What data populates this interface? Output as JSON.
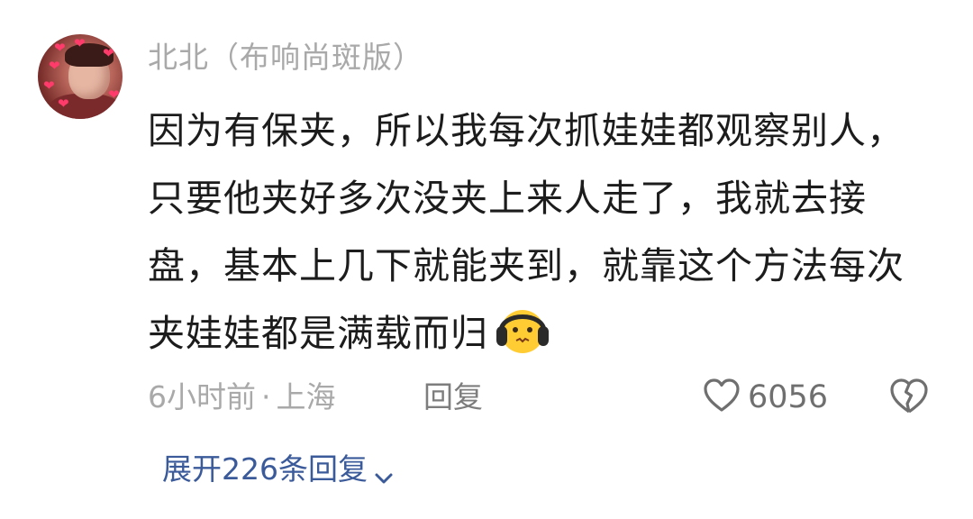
{
  "comment": {
    "username": "北北（布响尚斑版）",
    "text": "因为有保夹，所以我每次抓娃娃都观察别人，只要他夹好多次没夹上来人走了，我就去接盘，基本上几下就能夹到，就靠这个方法每次夹娃娃都是满载而归",
    "emoji_icon": "headphones-face-emoji",
    "time": "6小时前",
    "separator": "·",
    "location": "上海",
    "reply_label": "回复",
    "like_count": "6056",
    "expand_label": "展开226条回复"
  },
  "colors": {
    "text": "#1c1c1c",
    "meta": "#a9a9a9",
    "link": "#3a5a9a",
    "heart_avatar": "#ff3b6b"
  }
}
